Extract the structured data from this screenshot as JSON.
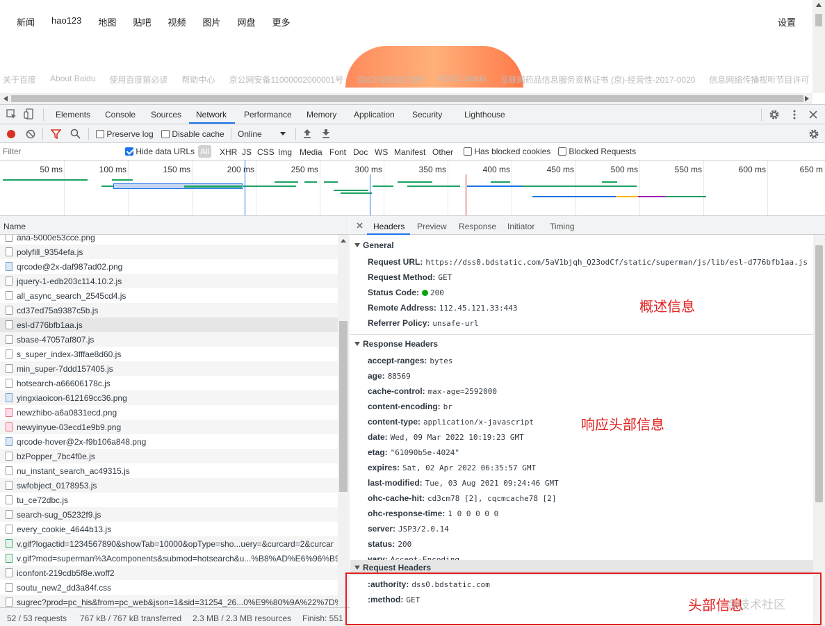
{
  "page": {
    "nav": [
      "新闻",
      "hao123",
      "地图",
      "贴吧",
      "视频",
      "图片",
      "网盘",
      "更多"
    ],
    "settings": "设置",
    "footer_links": [
      "关于百度",
      "About Baidu",
      "使用百度前必读",
      "帮助中心",
      "京公网安备11000002000001号",
      "京ICP证030173号",
      "©2022 Baidu",
      "互联网药品信息服务资格证书 (京)-经营性-2017-0020",
      "信息网络传播视听节目许可"
    ]
  },
  "devtools": {
    "tabs": [
      "Elements",
      "Console",
      "Sources",
      "Network",
      "Performance",
      "Memory",
      "Application",
      "Security",
      "Lighthouse"
    ],
    "active_tab": "Network",
    "toolbar": {
      "preserve_log": "Preserve log",
      "disable_cache": "Disable cache",
      "throttle": "Online"
    },
    "filter": {
      "placeholder": "Filter",
      "hide_data_urls": "Hide data URLs",
      "types": [
        "All",
        "XHR",
        "JS",
        "CSS",
        "Img",
        "Media",
        "Font",
        "Doc",
        "WS",
        "Manifest",
        "Other"
      ],
      "has_blocked_cookies": "Has blocked cookies",
      "blocked_requests": "Blocked Requests"
    },
    "timeline_ticks": [
      "50 ms",
      "100 ms",
      "150 ms",
      "200 ms",
      "250 ms",
      "300 ms",
      "350 ms",
      "400 ms",
      "450 ms",
      "500 ms",
      "550 ms",
      "600 ms",
      "650 m"
    ],
    "name_header": "Name",
    "requests": [
      {
        "name": "ana-5000e53cce.png",
        "type": "file"
      },
      {
        "name": "polyfill_9354efa.js",
        "type": "file"
      },
      {
        "name": "qrcode@2x-daf987ad02.png",
        "type": "img"
      },
      {
        "name": "jquery-1-edb203c114.10.2.js",
        "type": "file"
      },
      {
        "name": "all_async_search_2545cd4.js",
        "type": "file"
      },
      {
        "name": "cd37ed75a9387c5b.js",
        "type": "file"
      },
      {
        "name": "esl-d776bfb1aa.js",
        "type": "file",
        "selected": true
      },
      {
        "name": "sbase-47057af807.js",
        "type": "file"
      },
      {
        "name": "s_super_index-3fffae8d60.js",
        "type": "file"
      },
      {
        "name": "min_super-7ddd157405.js",
        "type": "file"
      },
      {
        "name": "hotsearch-a66606178c.js",
        "type": "file"
      },
      {
        "name": "yingxiaoicon-612169cc36.png",
        "type": "img"
      },
      {
        "name": "newzhibo-a6a0831ecd.png",
        "type": "img-red"
      },
      {
        "name": "newyinyue-03ecd1e9b9.png",
        "type": "img-red"
      },
      {
        "name": "qrcode-hover@2x-f9b106a848.png",
        "type": "img"
      },
      {
        "name": "bzPopper_7bc4f0e.js",
        "type": "file"
      },
      {
        "name": "nu_instant_search_ac49315.js",
        "type": "file"
      },
      {
        "name": "swfobject_0178953.js",
        "type": "file"
      },
      {
        "name": "tu_ce72dbc.js",
        "type": "file"
      },
      {
        "name": "search-sug_05232f9.js",
        "type": "file"
      },
      {
        "name": "every_cookie_4644b13.js",
        "type": "file"
      },
      {
        "name": "v.gif?logactid=1234567890&showTab=10000&opType=sho...uery=&curcard=2&curcar",
        "type": "gif"
      },
      {
        "name": "v.gif?mod=superman%3Acomponents&submod=hotsearch&u...%B8%AD%E6%96%B9.",
        "type": "gif"
      },
      {
        "name": "iconfont-219cdb5f8e.woff2",
        "type": "file"
      },
      {
        "name": "soutu_new2_dd3a84f.css",
        "type": "file"
      },
      {
        "name": "sugrec?prod=pc_his&from=pc_web&json=1&sid=31254_26...0%E9%80%9A%22%7D%",
        "type": "file"
      }
    ],
    "status": {
      "requests": "52 / 53 requests",
      "transferred": "767 kB / 767 kB transferred",
      "resources": "2.3 MB / 2.3 MB resources",
      "finish": "Finish: 551"
    },
    "detail_tabs": [
      "Headers",
      "Preview",
      "Response",
      "Initiator",
      "Timing"
    ],
    "general": {
      "title": "General",
      "items": [
        {
          "k": "Request URL:",
          "v": "https://dss0.bdstatic.com/5aV1bjqh_Q23odCf/static/superman/js/lib/esl-d776bfb1aa.js"
        },
        {
          "k": "Request Method:",
          "v": "GET"
        },
        {
          "k": "Status Code:",
          "v": "200"
        },
        {
          "k": "Remote Address:",
          "v": "112.45.121.33:443"
        },
        {
          "k": "Referrer Policy:",
          "v": "unsafe-url"
        }
      ]
    },
    "response_headers": {
      "title": "Response Headers",
      "items": [
        {
          "k": "accept-ranges:",
          "v": "bytes"
        },
        {
          "k": "age:",
          "v": "88569"
        },
        {
          "k": "cache-control:",
          "v": "max-age=2592000"
        },
        {
          "k": "content-encoding:",
          "v": "br"
        },
        {
          "k": "content-type:",
          "v": "application/x-javascript"
        },
        {
          "k": "date:",
          "v": "Wed, 09 Mar 2022 10:19:23 GMT"
        },
        {
          "k": "etag:",
          "v": "\"61090b5e-4024\""
        },
        {
          "k": "expires:",
          "v": "Sat, 02 Apr 2022 06:35:57 GMT"
        },
        {
          "k": "last-modified:",
          "v": "Tue, 03 Aug 2021 09:24:46 GMT"
        },
        {
          "k": "ohc-cache-hit:",
          "v": "cd3cm78 [2], cqcmcache78 [2]"
        },
        {
          "k": "ohc-response-time:",
          "v": "1 0 0 0 0 0"
        },
        {
          "k": "server:",
          "v": "JSP3/2.0.14"
        },
        {
          "k": "status:",
          "v": "200"
        },
        {
          "k": "vary:",
          "v": "Accept-Encoding"
        }
      ]
    },
    "request_headers": {
      "title": "Request Headers",
      "items": [
        {
          "k": ":authority:",
          "v": "dss0.bdstatic.com"
        },
        {
          "k": ":method:",
          "v": "GET"
        }
      ]
    },
    "annotations": {
      "general": "概述信息",
      "response": "响应头部信息",
      "request": "头部信息"
    },
    "watermark": "金技术社区",
    "colors": {
      "accent": "#1a73e8",
      "annotation": "#e02020",
      "record": "#d93025",
      "status_ok": "#0ca30c"
    }
  }
}
